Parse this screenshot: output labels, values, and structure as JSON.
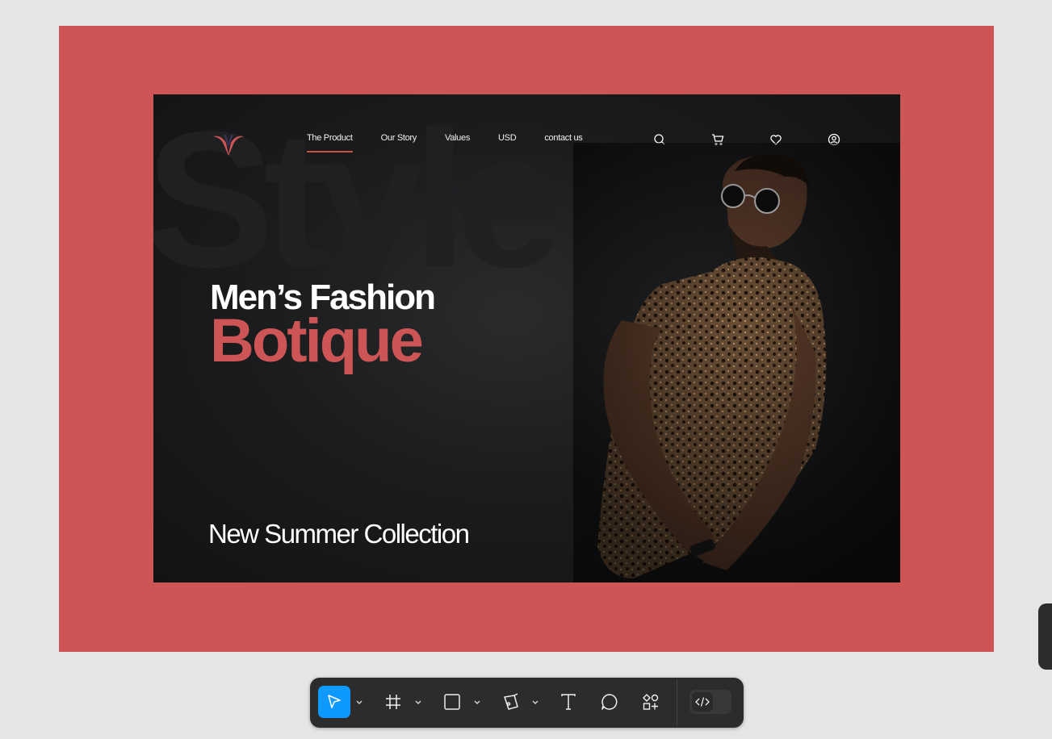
{
  "nav": {
    "items": [
      {
        "label": "The Product",
        "active": true
      },
      {
        "label": "Our Story",
        "active": false
      },
      {
        "label": "Values",
        "active": false
      },
      {
        "label": "USD",
        "active": false
      },
      {
        "label": "contact us",
        "active": false
      }
    ]
  },
  "header_icons": [
    "search-icon",
    "cart-icon",
    "heart-icon",
    "user-icon"
  ],
  "hero": {
    "watermark": "Style",
    "headline_line1": "Men’s Fashion",
    "headline_line2": "Botique",
    "subtitle": "New Summer Collection"
  },
  "colors": {
    "frame_bg": "#cd5555",
    "hero_bg": "#1b1c1e",
    "accent": "#c9533f",
    "toolbar_bg": "#2c2c2c",
    "toolbar_active": "#0d99ff"
  },
  "toolbar": {
    "tools": [
      {
        "name": "move-tool",
        "icon": "cursor-icon",
        "active": true,
        "has_dropdown": true
      },
      {
        "name": "frame-tool",
        "icon": "hash-icon",
        "active": false,
        "has_dropdown": true
      },
      {
        "name": "shape-tool",
        "icon": "square-icon",
        "active": false,
        "has_dropdown": true
      },
      {
        "name": "pen-tool",
        "icon": "pen-icon",
        "active": false,
        "has_dropdown": true
      },
      {
        "name": "text-tool",
        "icon": "text-icon",
        "active": false,
        "has_dropdown": false
      },
      {
        "name": "comment-tool",
        "icon": "comment-icon",
        "active": false,
        "has_dropdown": false
      },
      {
        "name": "actions-tool",
        "icon": "shapes-icon",
        "active": false,
        "has_dropdown": false
      },
      {
        "name": "dev-mode-toggle",
        "icon": "code-icon",
        "active": false,
        "has_dropdown": false
      }
    ]
  }
}
